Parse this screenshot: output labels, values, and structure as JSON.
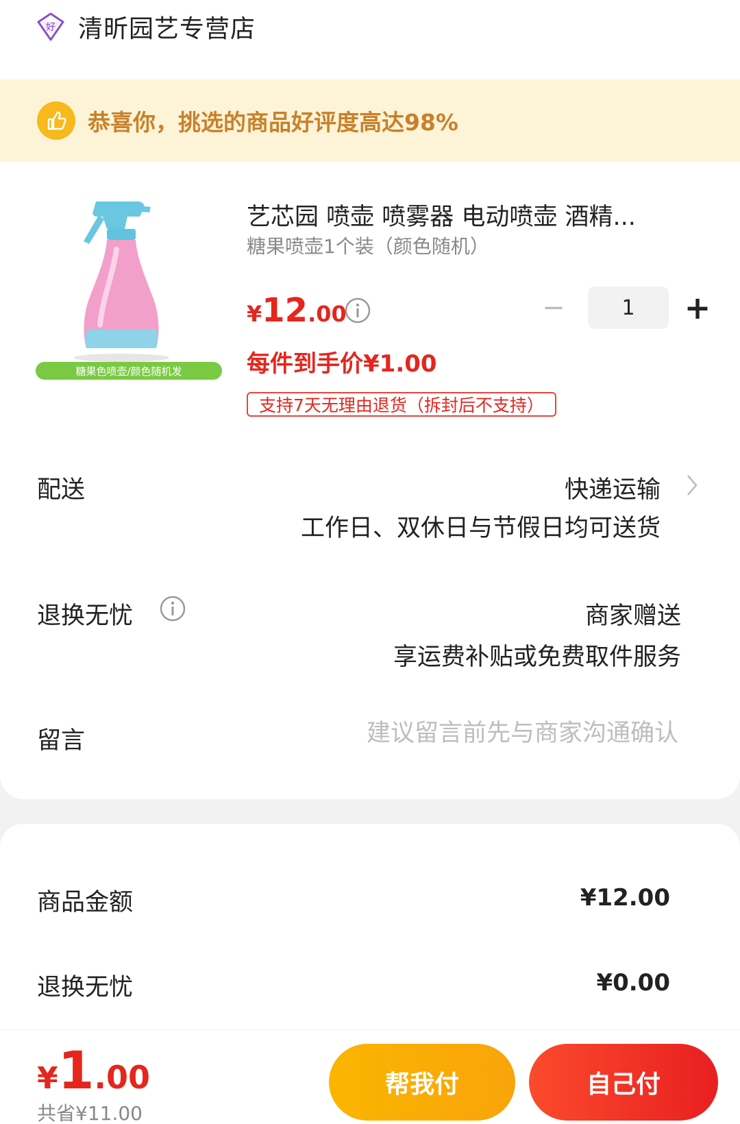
{
  "store": {
    "name": "清昕园艺专营店",
    "icon": "diamond-good-icon"
  },
  "banner": {
    "text": "恭喜你，挑选的商品好评度高达98%",
    "icon": "thumbs-up-icon"
  },
  "product": {
    "title": "艺芯园 喷壶 喷雾器 电动喷壶 酒精...",
    "spec": "糖果喷壶1个装（颜色随机）",
    "image_caption": "糖果色喷壶/颜色随机发",
    "price_yen": "¥",
    "price_int": "12",
    "price_dec": ".00",
    "unit_price": "每件到手价¥1.00",
    "return_tag": "支持7天无理由退货（拆封后不支持）",
    "quantity": "1",
    "minus": "−",
    "plus": "+"
  },
  "delivery": {
    "label": "配送",
    "method": "快递运输",
    "detail": "工作日、双休日与节假日均可送货"
  },
  "returns": {
    "label": "退换无忧",
    "value": "商家赠送",
    "detail": "享运费补贴或免费取件服务"
  },
  "message": {
    "label": "留言",
    "placeholder": "建议留言前先与商家沟通确认"
  },
  "summary": {
    "goods_label": "商品金额",
    "goods_value": "¥12.00",
    "returns_label": "退换无忧",
    "returns_value": "¥0.00"
  },
  "footer": {
    "total_yen": "¥",
    "total_int": "1",
    "total_dec": ".00",
    "saved": "共省¥11.00",
    "help_pay": "帮我付",
    "self_pay": "自己付"
  },
  "colors": {
    "accent_red": "#e4261d",
    "accent_orange": "#fbb500",
    "banner_bg": "#fdf4d8"
  }
}
